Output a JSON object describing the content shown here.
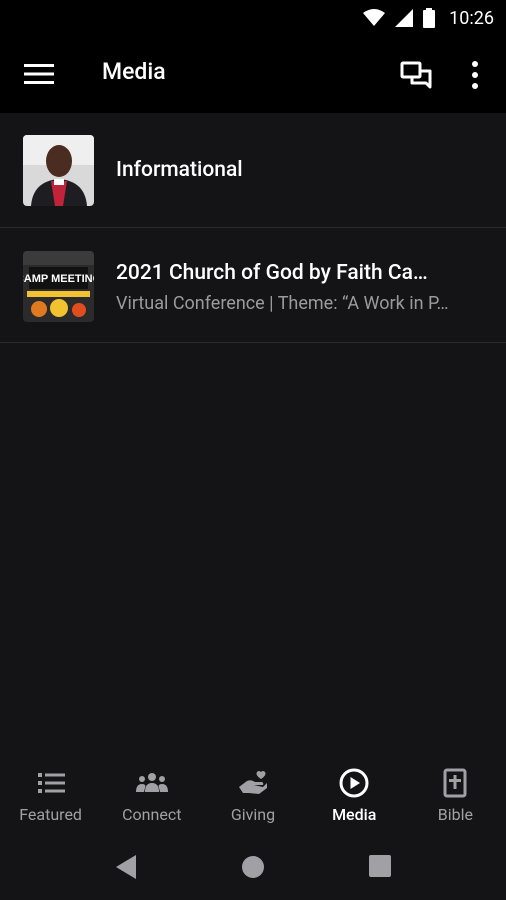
{
  "status": {
    "time": "10:26"
  },
  "appbar": {
    "title": "Media"
  },
  "list": {
    "items": [
      {
        "title": "Informational",
        "subtitle": ""
      },
      {
        "title": "2021 Church of God by Faith Ca…",
        "subtitle": "Virtual Conference | Theme: “A Work in P…",
        "thumb_text": "CAMP MEETING"
      }
    ]
  },
  "bottom_nav": {
    "items": [
      {
        "label": "Featured",
        "icon": "list-icon"
      },
      {
        "label": "Connect",
        "icon": "people-icon"
      },
      {
        "label": "Giving",
        "icon": "hand-heart-icon"
      },
      {
        "label": "Media",
        "icon": "play-circle-icon"
      },
      {
        "label": "Bible",
        "icon": "bible-icon"
      }
    ],
    "active": "Media"
  },
  "colors": {
    "background": "#141416",
    "appbar": "#000000",
    "inactive": "#a0a0a5"
  }
}
